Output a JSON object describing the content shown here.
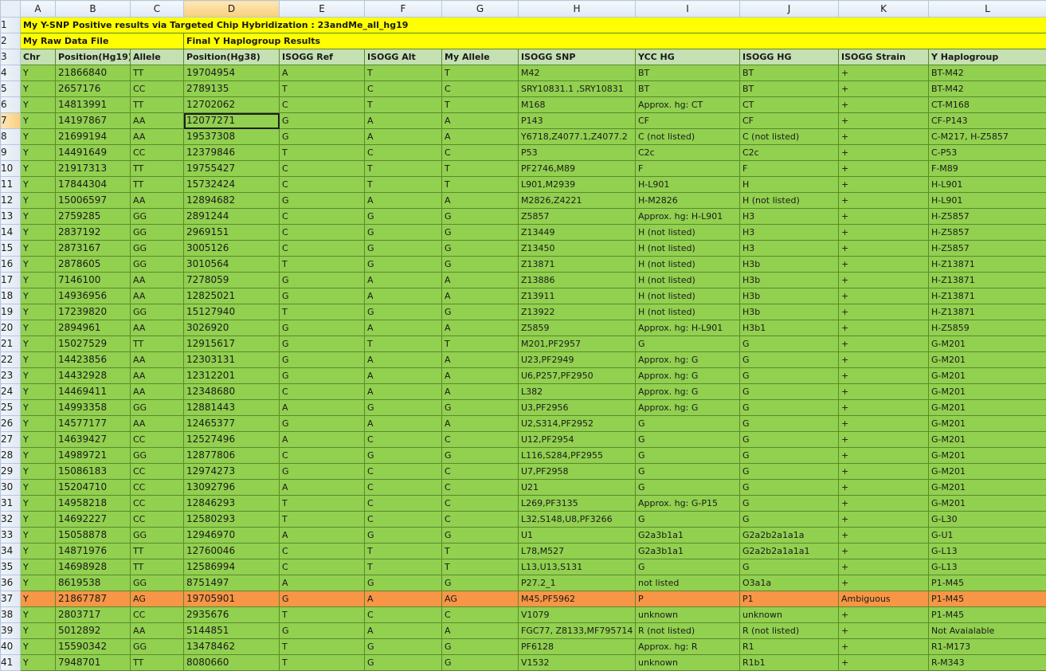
{
  "columns": [
    "A",
    "B",
    "C",
    "D",
    "E",
    "F",
    "G",
    "H",
    "I",
    "J",
    "K",
    "L"
  ],
  "selected_col": "D",
  "selected_row": 7,
  "row1": {
    "num": "1",
    "text": "My Y-SNP Positive results via Targeted Chip Hybridization : 23andMe_all_hg19"
  },
  "row2": {
    "num": "2",
    "left": "My Raw Data File",
    "right": "Final Y Haplogroup Results"
  },
  "row3": {
    "num": "3",
    "headers": [
      "Chr",
      "Position(Hg19)",
      "Allele",
      "Position(Hg38)",
      "ISOGG Ref",
      "ISOGG Alt",
      "My Allele",
      "ISOGG SNP",
      "YCC HG",
      "ISOGG HG",
      "ISOGG Strain",
      "Y Haplogroup"
    ]
  },
  "rows": [
    [
      "Y",
      "21866840",
      "TT",
      "19704954",
      "A",
      "T",
      "T",
      "M42",
      "BT",
      "BT",
      "+",
      "BT-M42"
    ],
    [
      "Y",
      "2657176",
      "CC",
      "2789135",
      "T",
      "C",
      "C",
      "SRY10831.1 ,SRY10831",
      "BT",
      "BT",
      "+",
      "BT-M42"
    ],
    [
      "Y",
      "14813991",
      "TT",
      "12702062",
      "C",
      "T",
      "T",
      "M168",
      "Approx. hg: CT",
      "CT",
      "+",
      "CT-M168"
    ],
    [
      "Y",
      "14197867",
      "AA",
      "12077271",
      "G",
      "A",
      "A",
      "P143",
      "CF",
      "CF",
      "+",
      "CF-P143"
    ],
    [
      "Y",
      "21699194",
      "AA",
      "19537308",
      "G",
      "A",
      "A",
      "Y6718,Z4077.1,Z4077.2",
      "C (not listed)",
      "C (not listed)",
      "+",
      "C-M217, H-Z5857"
    ],
    [
      "Y",
      "14491649",
      "CC",
      "12379846",
      "T",
      "C",
      "C",
      "P53",
      "C2c",
      "C2c",
      "+",
      "C-P53"
    ],
    [
      "Y",
      "21917313",
      "TT",
      "19755427",
      "C",
      "T",
      "T",
      "PF2746,M89",
      "F",
      "F",
      "+",
      "F-M89"
    ],
    [
      "Y",
      "17844304",
      "TT",
      "15732424",
      "C",
      "T",
      "T",
      "L901,M2939",
      "H-L901",
      "H",
      "+",
      "H-L901"
    ],
    [
      "Y",
      "15006597",
      "AA",
      "12894682",
      "G",
      "A",
      "A",
      "M2826,Z4221",
      "H-M2826",
      "H (not listed)",
      "+",
      "H-L901"
    ],
    [
      "Y",
      "2759285",
      "GG",
      "2891244",
      "C",
      "G",
      "G",
      "Z5857",
      "Approx. hg: H-L901",
      "H3",
      "+",
      "H-Z5857"
    ],
    [
      "Y",
      "2837192",
      "GG",
      "2969151",
      "C",
      "G",
      "G",
      "Z13449",
      "H (not listed)",
      "H3",
      "+",
      "H-Z5857"
    ],
    [
      "Y",
      "2873167",
      "GG",
      "3005126",
      "C",
      "G",
      "G",
      "Z13450",
      "H (not listed)",
      "H3",
      "+",
      "H-Z5857"
    ],
    [
      "Y",
      "2878605",
      "GG",
      "3010564",
      "T",
      "G",
      "G",
      "Z13871",
      "H (not listed)",
      "H3b",
      "+",
      "H-Z13871"
    ],
    [
      "Y",
      "7146100",
      "AA",
      "7278059",
      "G",
      "A",
      "A",
      "Z13886",
      "H (not listed)",
      "H3b",
      "+",
      "H-Z13871"
    ],
    [
      "Y",
      "14936956",
      "AA",
      "12825021",
      "G",
      "A",
      "A",
      "Z13911",
      "H (not listed)",
      "H3b",
      "+",
      "H-Z13871"
    ],
    [
      "Y",
      "17239820",
      "GG",
      "15127940",
      "T",
      "G",
      "G",
      "Z13922",
      "H (not listed)",
      "H3b",
      "+",
      "H-Z13871"
    ],
    [
      "Y",
      "2894961",
      "AA",
      "3026920",
      "G",
      "A",
      "A",
      "Z5859",
      "Approx. hg: H-L901",
      "H3b1",
      "+",
      "H-Z5859"
    ],
    [
      "Y",
      "15027529",
      "TT",
      "12915617",
      "G",
      "T",
      "T",
      "M201,PF2957",
      "G",
      "G",
      "+",
      "G-M201"
    ],
    [
      "Y",
      "14423856",
      "AA",
      "12303131",
      "G",
      "A",
      "A",
      "U23,PF2949",
      "Approx. hg: G",
      "G",
      "+",
      "G-M201"
    ],
    [
      "Y",
      "14432928",
      "AA",
      "12312201",
      "G",
      "A",
      "A",
      "U6,P257,PF2950",
      "Approx. hg: G",
      "G",
      "+",
      "G-M201"
    ],
    [
      "Y",
      "14469411",
      "AA",
      "12348680",
      "C",
      "A",
      "A",
      "L382",
      "Approx. hg: G",
      "G",
      "+",
      "G-M201"
    ],
    [
      "Y",
      "14993358",
      "GG",
      "12881443",
      "A",
      "G",
      "G",
      "U3,PF2956",
      "Approx. hg: G",
      "G",
      "+",
      "G-M201"
    ],
    [
      "Y",
      "14577177",
      "AA",
      "12465377",
      "G",
      "A",
      "A",
      "U2,S314,PF2952",
      "G",
      "G",
      "+",
      "G-M201"
    ],
    [
      "Y",
      "14639427",
      "CC",
      "12527496",
      "A",
      "C",
      "C",
      "U12,PF2954",
      "G",
      "G",
      "+",
      "G-M201"
    ],
    [
      "Y",
      "14989721",
      "GG",
      "12877806",
      "C",
      "G",
      "G",
      "L116,S284,PF2955",
      "G",
      "G",
      "+",
      "G-M201"
    ],
    [
      "Y",
      "15086183",
      "CC",
      "12974273",
      "G",
      "C",
      "C",
      "U7,PF2958",
      "G",
      "G",
      "+",
      "G-M201"
    ],
    [
      "Y",
      "15204710",
      "CC",
      "13092796",
      "A",
      "C",
      "C",
      "U21",
      "G",
      "G",
      "+",
      "G-M201"
    ],
    [
      "Y",
      "14958218",
      "CC",
      "12846293",
      "T",
      "C",
      "C",
      "L269,PF3135",
      "Approx. hg: G-P15",
      "G",
      "+",
      "G-M201"
    ],
    [
      "Y",
      "14692227",
      "CC",
      "12580293",
      "T",
      "C",
      "C",
      "L32,S148,U8,PF3266",
      "G",
      "G",
      "+",
      "G-L30"
    ],
    [
      "Y",
      "15058878",
      "GG",
      "12946970",
      "A",
      "G",
      "G",
      "U1",
      "G2a3b1a1",
      "G2a2b2a1a1a",
      "+",
      "G-U1"
    ],
    [
      "Y",
      "14871976",
      "TT",
      "12760046",
      "C",
      "T",
      "T",
      "L78,M527",
      "G2a3b1a1",
      "G2a2b2a1a1a1",
      "+",
      "G-L13"
    ],
    [
      "Y",
      "14698928",
      "TT",
      "12586994",
      "C",
      "T",
      "T",
      "L13,U13,S131",
      "G",
      "G",
      "+",
      "G-L13"
    ],
    [
      "Y",
      "8619538",
      "GG",
      "8751497",
      "A",
      "G",
      "G",
      "P27.2_1",
      "not listed",
      "O3a1a",
      "+",
      "P1-M45"
    ],
    [
      "Y",
      "21867787",
      "AG",
      "19705901",
      "G",
      "A",
      "AG",
      "M45,PF5962",
      "P",
      "P1",
      "Ambiguous",
      "P1-M45"
    ],
    [
      "Y",
      "2803717",
      "CC",
      "2935676",
      "T",
      "C",
      "C",
      "V1079",
      "unknown",
      "unknown",
      "+",
      "P1-M45"
    ],
    [
      "Y",
      "5012892",
      "AA",
      "5144851",
      "G",
      "A",
      "A",
      "FGC77, Z8133,MF795714",
      "R (not listed)",
      "R (not listed)",
      "+",
      "Not Avaialable"
    ],
    [
      "Y",
      "15590342",
      "GG",
      "13478462",
      "T",
      "G",
      "G",
      "PF6128",
      "Approx. hg: R",
      "R1",
      "+",
      "R1-M173"
    ],
    [
      "Y",
      "7948701",
      "TT",
      "8080660",
      "T",
      "G",
      "G",
      "V1532",
      "unknown",
      "R1b1",
      "+",
      "R-M343"
    ]
  ],
  "highlight_row": 37,
  "colors": {
    "green": "#92d050",
    "yellow": "#ffff00",
    "orange": "#f79646",
    "header": "#c5e0b3"
  }
}
